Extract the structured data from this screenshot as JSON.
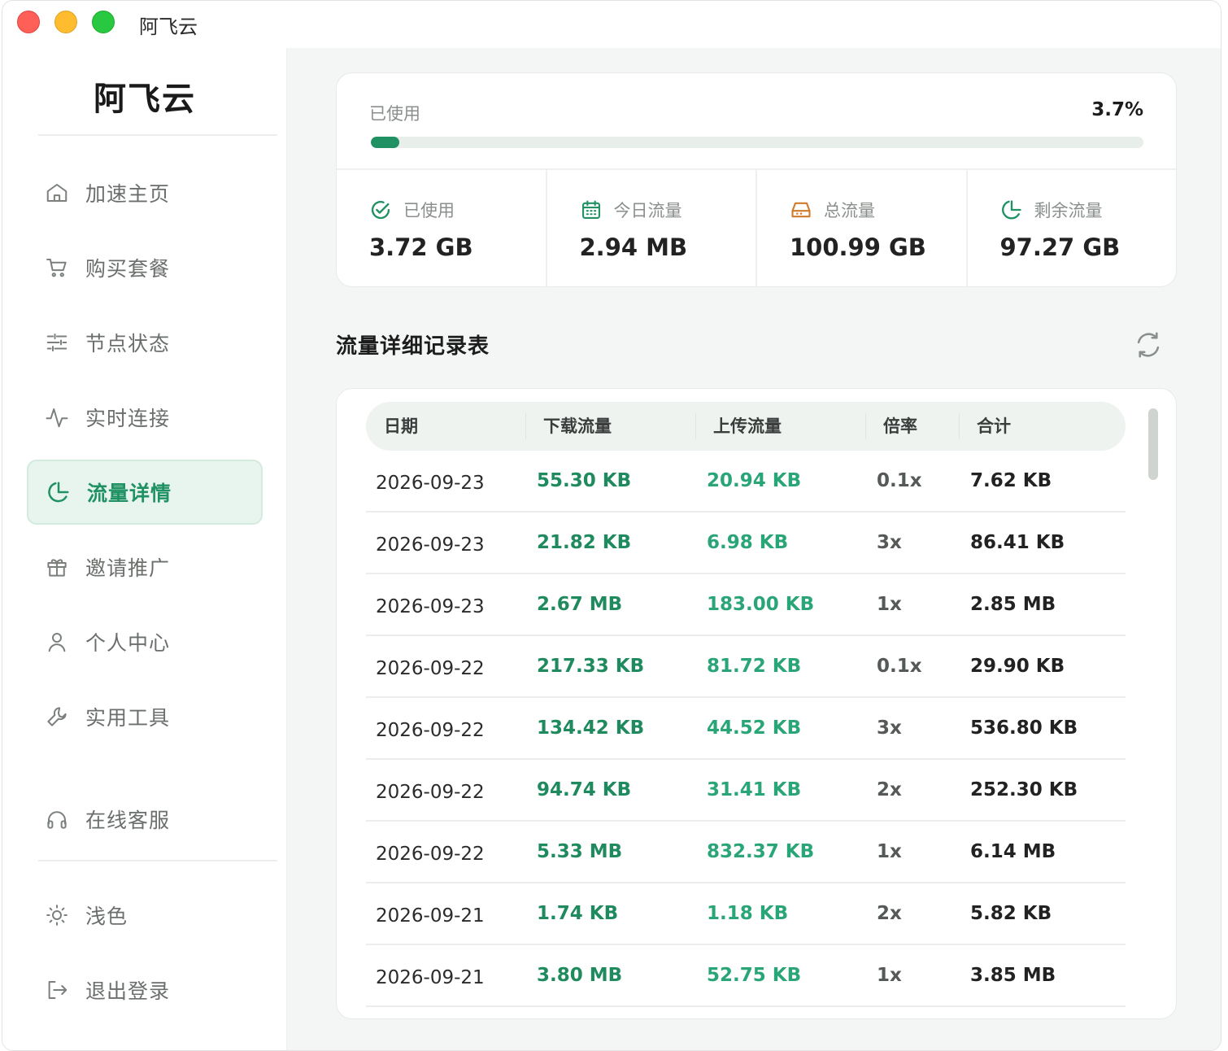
{
  "window": {
    "title": "阿飞云"
  },
  "sidebar": {
    "brand": "阿飞云",
    "items": [
      {
        "label": "加速主页",
        "icon": "home-icon"
      },
      {
        "label": "购买套餐",
        "icon": "cart-icon"
      },
      {
        "label": "节点状态",
        "icon": "sliders-icon"
      },
      {
        "label": "实时连接",
        "icon": "pulse-icon"
      },
      {
        "label": "流量详情",
        "icon": "pie-chart-icon",
        "active": true
      },
      {
        "label": "邀请推广",
        "icon": "gift-icon"
      },
      {
        "label": "个人中心",
        "icon": "user-icon"
      },
      {
        "label": "实用工具",
        "icon": "wrench-icon"
      },
      {
        "label": "在线客服",
        "icon": "headphones-icon"
      },
      {
        "label": "浅色",
        "icon": "sun-icon"
      },
      {
        "label": "退出登录",
        "icon": "logout-icon"
      }
    ]
  },
  "usage": {
    "label": "已使用",
    "percent_text": "3.7%",
    "percent": 3.7,
    "stats": [
      {
        "label": "已使用",
        "value": "3.72 GB",
        "icon": "check-circle-icon",
        "color": "#1f9163"
      },
      {
        "label": "今日流量",
        "value": "2.94 MB",
        "icon": "calendar-icon",
        "color": "#1f9163"
      },
      {
        "label": "总流量",
        "value": "100.99 GB",
        "icon": "drive-icon",
        "color": "#d07a2c"
      },
      {
        "label": "剩余流量",
        "value": "97.27 GB",
        "icon": "pie-chart-icon",
        "color": "#1f9163"
      }
    ]
  },
  "records": {
    "title": "流量详细记录表",
    "columns": [
      "日期",
      "下载流量",
      "上传流量",
      "倍率",
      "合计"
    ],
    "rows": [
      [
        "2026-09-23",
        "55.30 KB",
        "20.94 KB",
        "0.1x",
        "7.62 KB"
      ],
      [
        "2026-09-23",
        "21.82 KB",
        "6.98 KB",
        "3x",
        "86.41 KB"
      ],
      [
        "2026-09-23",
        "2.67 MB",
        "183.00 KB",
        "1x",
        "2.85 MB"
      ],
      [
        "2026-09-22",
        "217.33 KB",
        "81.72 KB",
        "0.1x",
        "29.90 KB"
      ],
      [
        "2026-09-22",
        "134.42 KB",
        "44.52 KB",
        "3x",
        "536.80 KB"
      ],
      [
        "2026-09-22",
        "94.74 KB",
        "31.41 KB",
        "2x",
        "252.30 KB"
      ],
      [
        "2026-09-22",
        "5.33 MB",
        "832.37 KB",
        "1x",
        "6.14 MB"
      ],
      [
        "2026-09-21",
        "1.74 KB",
        "1.18 KB",
        "2x",
        "5.82 KB"
      ],
      [
        "2026-09-21",
        "3.80 MB",
        "52.75 KB",
        "1x",
        "3.85 MB"
      ]
    ]
  },
  "colors": {
    "accent": "#1f9163",
    "accent_light": "#e8f4ee",
    "orange": "#d07a2c"
  }
}
